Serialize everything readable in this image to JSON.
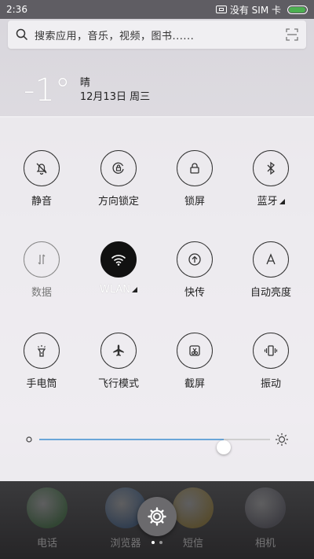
{
  "status_bar": {
    "time": "2:36",
    "no_sim_text": "没有 SIM 卡",
    "battery_level": 0.95
  },
  "search": {
    "placeholder": "搜索应用，音乐，视频，图书......"
  },
  "weather": {
    "temp": "-1°",
    "condition": "晴",
    "date": "12月13日 周三"
  },
  "toggles": [
    {
      "label": "静音",
      "icon": "bell-off-icon",
      "state": "off"
    },
    {
      "label": "方向锁定",
      "icon": "rotation-lock-icon",
      "state": "off"
    },
    {
      "label": "锁屏",
      "icon": "lock-icon",
      "state": "off"
    },
    {
      "label": "蓝牙",
      "icon": "bluetooth-icon",
      "state": "off",
      "has_menu": true
    },
    {
      "label": "数据",
      "icon": "mobile-data-icon",
      "state": "disabled"
    },
    {
      "label": "WLAN",
      "icon": "wifi-icon",
      "state": "on",
      "has_menu": true
    },
    {
      "label": "快传",
      "icon": "quick-transfer-icon",
      "state": "off"
    },
    {
      "label": "自动亮度",
      "icon": "auto-brightness-icon",
      "state": "off"
    },
    {
      "label": "手电筒",
      "icon": "flashlight-icon",
      "state": "off"
    },
    {
      "label": "飞行模式",
      "icon": "airplane-icon",
      "state": "off"
    },
    {
      "label": "截屏",
      "icon": "screenshot-icon",
      "state": "off"
    },
    {
      "label": "振动",
      "icon": "vibrate-icon",
      "state": "off"
    }
  ],
  "brightness": {
    "value": 0.8
  },
  "dock": {
    "apps": [
      {
        "label": "电话",
        "color": "#3a8a3c"
      },
      {
        "label": "浏览器",
        "color": "#3a6fb0"
      },
      {
        "label": "短信",
        "color": "#c9a12b"
      },
      {
        "label": "相机",
        "color": "#6a6a7a"
      }
    ]
  },
  "colors": {
    "accent": "#6aa6d8",
    "active_toggle": "#111111",
    "battery": "#4caf50"
  }
}
